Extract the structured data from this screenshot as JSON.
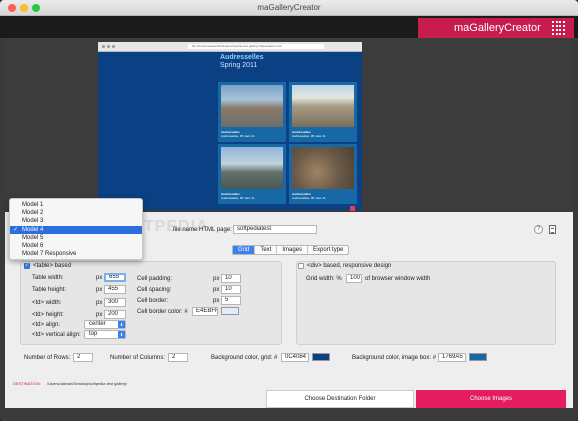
{
  "window": {
    "title": "maGalleryCreator"
  },
  "brand": {
    "name": "maGalleryCreator",
    "color": "#c81c4f"
  },
  "preview": {
    "url": "file:///Users/ulaivan/Desktop/softpedia test gallery/softpediatest.html",
    "gallery_title": "Audresselles",
    "gallery_subtitle": "Spring 2011",
    "thumbs": [
      {
        "caption": "Audresselles, 05 mars 11",
        "label": "Audresselles"
      },
      {
        "caption": "Audresselles, 05 mars 11",
        "label": "Audresselles"
      },
      {
        "caption": "Audresselles, 05 mars 11",
        "label": "Audresselles"
      },
      {
        "caption": "Audresselles, 05 mars 11",
        "label": "Audresselles"
      }
    ]
  },
  "model_menu": {
    "items": [
      "Model 1",
      "Model 2",
      "Model 3",
      "Model 4",
      "Model 5",
      "Model 6",
      "Model 7 Responsive"
    ],
    "selected_index": 3
  },
  "watermark": "SOFTPEDIA",
  "file_name": {
    "label": "file name HTML page:",
    "value": "softpediatest"
  },
  "icons": {
    "help": "?",
    "document": "document-icon"
  },
  "tabs": [
    "Grid",
    "Text",
    "Images",
    "Export type"
  ],
  "active_tab": "Grid",
  "table_group": {
    "checkbox_label": "<table> based",
    "checked": true,
    "table_width": {
      "label": "Table width:",
      "unit": "px",
      "value": "655"
    },
    "table_height": {
      "label": "Table height:",
      "unit": "px",
      "value": "455"
    },
    "td_width": {
      "label": "<td> width:",
      "unit": "px",
      "value": "300"
    },
    "td_height": {
      "label": "<td> height:",
      "unit": "px",
      "value": "200"
    },
    "td_align": {
      "label": "<td> align:",
      "value": "center"
    },
    "td_valign": {
      "label": "<td> vertical align:",
      "value": "top"
    },
    "cell_padding": {
      "label": "Cell padding:",
      "unit": "px",
      "value": "10"
    },
    "cell_spacing": {
      "label": "Cell spacing:",
      "unit": "px",
      "value": "10"
    },
    "cell_border": {
      "label": "Cell border:",
      "unit": "px",
      "value": "5"
    },
    "cell_border_color": {
      "label": "Cell border color: #",
      "value": "E4EBFF",
      "swatch": "#E4EBFF"
    }
  },
  "div_group": {
    "checkbox_label": "<div> based, responsive design",
    "checked": false,
    "grid_width_label": "Grid width: %",
    "grid_width_value": "100",
    "grid_width_suffix": "of browser window width"
  },
  "bottom_row": {
    "rows_label": "Number of Rows:",
    "rows_value": "2",
    "cols_label": "Number of Columns:",
    "cols_value": "2",
    "bg_grid_label": "Background color, grid: #",
    "bg_grid_value": "0C4084",
    "bg_grid_swatch": "#0C4084",
    "bg_image_label": "Background color, image box: #",
    "bg_image_value": "1769A5",
    "bg_image_swatch": "#1769A5"
  },
  "destination": {
    "label": "DESTINATION:",
    "path": "/Users/ulaivan/Desktop/softpedia test gallery/"
  },
  "buttons": {
    "choose_destination": "Choose Destination Folder",
    "choose_images": "Choose Images"
  }
}
